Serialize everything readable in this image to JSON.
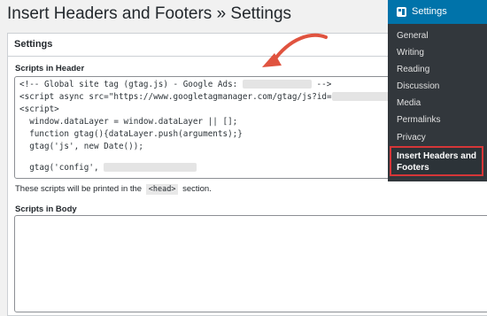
{
  "page": {
    "title": "Insert Headers and Footers » Settings"
  },
  "panel": {
    "title": "Settings",
    "header_section": {
      "label": "Scripts in Header",
      "code_lines": [
        "<!-- Global site tag (gtag.js) - Google Ads:",
        "<script async src=\"https://www.googletagmanager.com/gtag/js?id=",
        "<script>",
        "  window.dataLayer = window.dataLayer || [];",
        "  function gtag(){dataLayer.push(arguments);}",
        "  gtag('js', new Date());",
        "",
        "  gtag('config',"
      ],
      "comment_close": "-->",
      "hint_prefix": "These scripts will be printed in the",
      "hint_code": "<head>",
      "hint_suffix": "section."
    },
    "body_section": {
      "label": "Scripts in Body"
    }
  },
  "admin_menu": {
    "heading": "Settings",
    "heading_icon": "settings-icon",
    "items": [
      "General",
      "Writing",
      "Reading",
      "Discussion",
      "Media",
      "Permalinks",
      "Privacy"
    ],
    "active_item": "Insert Headers and Footers",
    "highlight_color": "#d63638",
    "accent_color": "#0073aa"
  },
  "annotation": {
    "arrow_color": "#e0533f"
  }
}
